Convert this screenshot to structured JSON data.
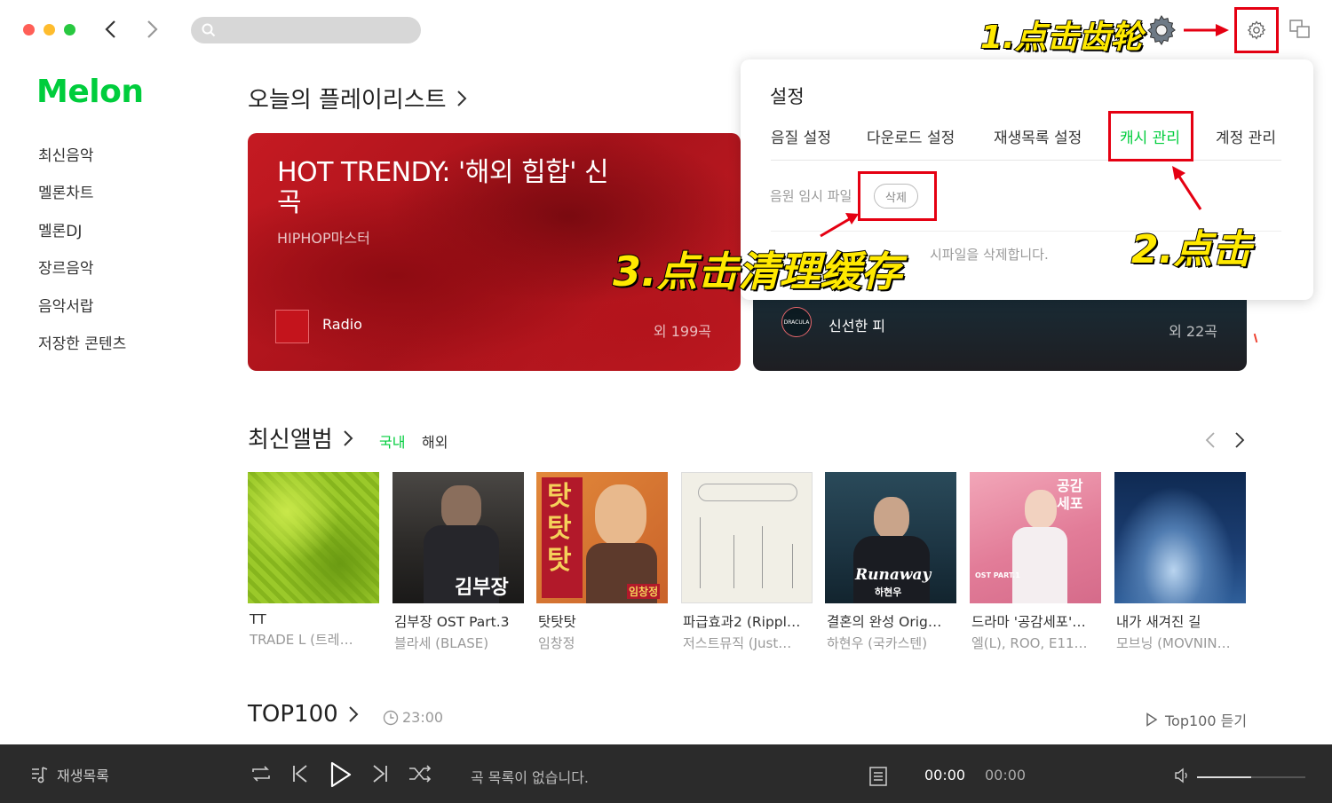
{
  "window": {
    "search_placeholder": ""
  },
  "brand": {
    "logo": "Melon",
    "accent": "#00cd3c"
  },
  "sidebar": {
    "items": [
      {
        "label": "최신음악"
      },
      {
        "label": "멜론차트"
      },
      {
        "label": "멜론DJ"
      },
      {
        "label": "장르음악"
      },
      {
        "label": "음악서랍"
      },
      {
        "label": "저장한 콘텐츠"
      }
    ]
  },
  "today_playlist": {
    "title": "오늘의 플레이리스트",
    "cards": [
      {
        "title": "HOT TRENDY: '해외 힙합' 신곡",
        "subtitle": "HIPHOP마스터",
        "label": "Radio",
        "count": "외 199곡"
      },
      {
        "title": "",
        "subtitle": "",
        "label": "신선한 피",
        "count": "외 22곡",
        "thumb": "DRACULA"
      }
    ]
  },
  "settings": {
    "title": "설정",
    "tabs": [
      {
        "label": "음질 설정"
      },
      {
        "label": "다운로드 설정"
      },
      {
        "label": "재생목록 설정"
      },
      {
        "label": "캐시 관리",
        "active": true
      },
      {
        "label": "계정 관리"
      }
    ],
    "cache_label": "음원 임시 파일",
    "delete_button": "삭제",
    "cache_description": "시파일을 삭제합니다."
  },
  "annotations": {
    "step1": "1.点击齿轮",
    "step2": "2.点击",
    "step3": "3.点击清理缓存",
    "highlight_color": "#e50012"
  },
  "new_albums": {
    "title": "최신앨범",
    "filters": [
      "국내",
      "해외"
    ],
    "active_filter": "국내",
    "albums": [
      {
        "name": "TT",
        "artist": "TRADE L (트레…"
      },
      {
        "name": "김부장 OST Part.3",
        "artist": "블라세 (BLASE)",
        "art_text": "김부장"
      },
      {
        "name": "탓탓탓",
        "artist": "임창정",
        "art_text": "탓탓탓",
        "art_sub": "임창정"
      },
      {
        "name": "파급효과2 (Rippl…",
        "artist": "저스트뮤직 (Just…"
      },
      {
        "name": "결혼의 완성 Orig…",
        "artist": "하현우 (국카스텐)",
        "art_text": "Runaway",
        "art_sub": "하현우"
      },
      {
        "name": "드라마 '공감세포'…",
        "artist": "엘(L), ROO, E11…",
        "art_text": "공감 세포",
        "art_sub": "OST PART.1"
      },
      {
        "name": "내가 새겨진 길",
        "artist": "모브닝 (MOVNIN…"
      }
    ]
  },
  "top100": {
    "title": "TOP100",
    "time": "23:00",
    "listen": "Top100 듣기"
  },
  "player": {
    "playlist_label": "재생목록",
    "empty_message": "곡 목록이 없습니다.",
    "current_time": "00:00",
    "total_time": "00:00",
    "volume": 0.5
  }
}
